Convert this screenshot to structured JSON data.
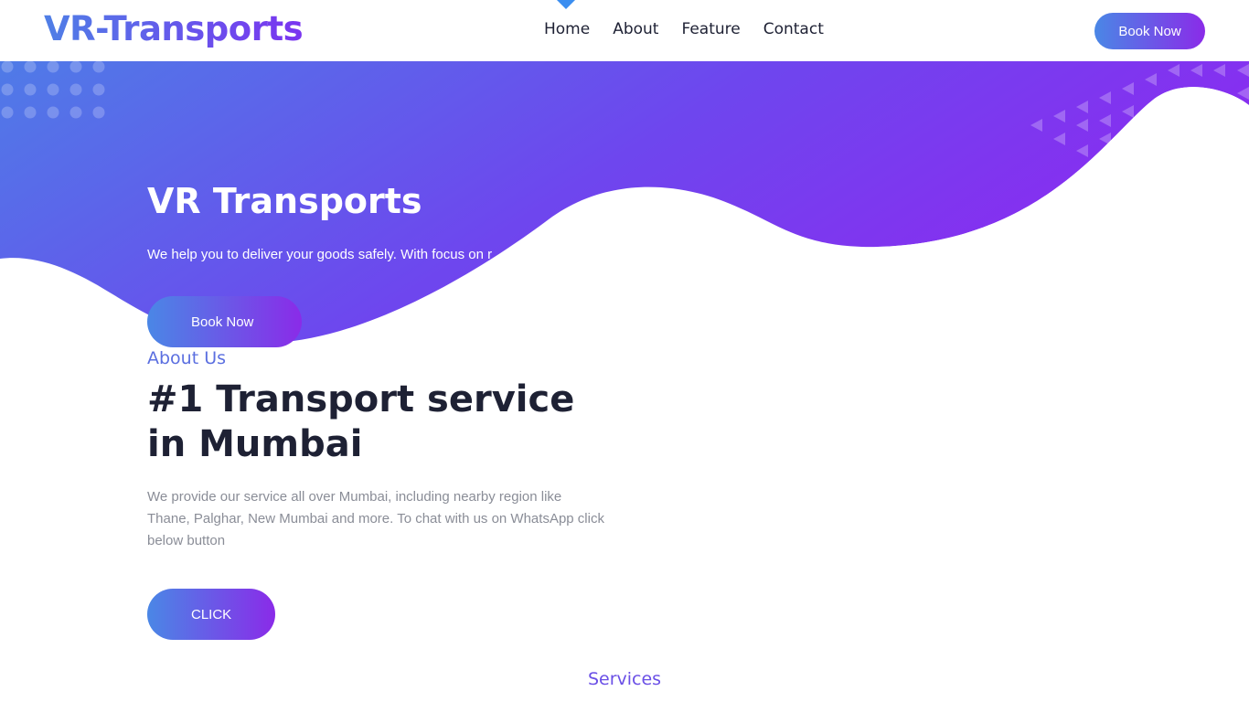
{
  "header": {
    "logo": "VR-Transports",
    "nav": [
      "Home",
      "About",
      "Feature",
      "Contact"
    ],
    "active_nav": "Home",
    "book_button": "Book Now"
  },
  "hero": {
    "title": "VR Transports",
    "subtitle": "We help you to deliver your goods safely. With focus on r",
    "book_button": "Book Now"
  },
  "about": {
    "eyebrow": "About Us",
    "title": "#1 Transport service in Mumbai",
    "text": "We provide our service all over Mumbai, including nearby region like Thane, Palghar, New Mumbai and more. To chat with us on WhatsApp click below button",
    "button": "CLICK"
  },
  "services": {
    "label": "Services"
  },
  "colors": {
    "gradient_start": "#4f7fe6",
    "gradient_end": "#8a2be8",
    "heading": "#1e2134",
    "accent": "#5b6fe0"
  }
}
